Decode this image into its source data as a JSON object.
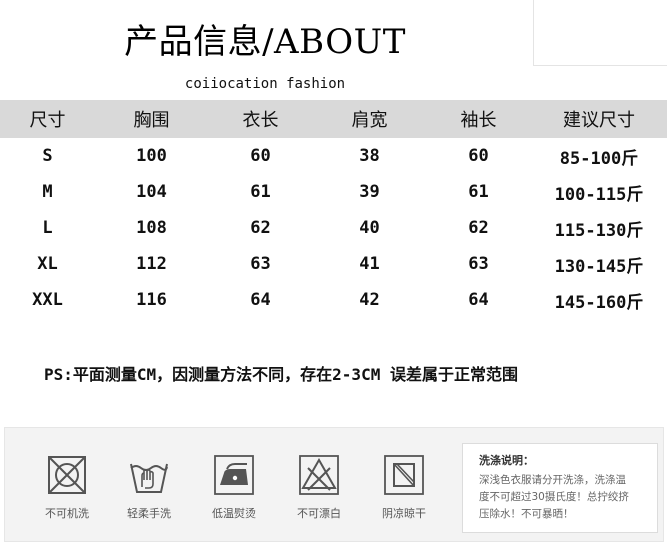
{
  "header": {
    "title": "产品信息/ABOUT",
    "subtitle": "coiiocation fashion"
  },
  "size_table": {
    "columns": [
      "尺寸",
      "胸围",
      "衣长",
      "肩宽",
      "袖长",
      "建议尺寸"
    ],
    "rows": [
      [
        "S",
        "100",
        "60",
        "38",
        "60",
        "85-100斤"
      ],
      [
        "M",
        "104",
        "61",
        "39",
        "61",
        "100-115斤"
      ],
      [
        "L",
        "108",
        "62",
        "40",
        "62",
        "115-130斤"
      ],
      [
        "XL",
        "112",
        "63",
        "41",
        "63",
        "130-145斤"
      ],
      [
        "XXL",
        "116",
        "64",
        "42",
        "64",
        "145-160斤"
      ]
    ]
  },
  "note": "PS:平面测量CM，因测量方法不同，存在2-3CM 误差属于正常范围",
  "care": {
    "items": [
      {
        "icon": "no-machine-wash-icon",
        "label": "不可机洗"
      },
      {
        "icon": "gentle-hand-wash-icon",
        "label": "轻柔手洗"
      },
      {
        "icon": "low-temp-iron-icon",
        "label": "低温熨烫"
      },
      {
        "icon": "no-bleach-icon",
        "label": "不可漂白"
      },
      {
        "icon": "shade-dry-icon",
        "label": "阴凉晾干"
      }
    ],
    "wash_title": "洗涤说明：",
    "wash_lines": [
      "深浅色衣服请分开洗涤，洗涤温",
      "度不可超过30摄氏度！总拧绞挤",
      "压除水！不可暴晒！"
    ]
  },
  "colors": {
    "header_bg": "#d9d9d9",
    "panel_bg": "#f3f3f3",
    "icon_stroke": "#555555"
  }
}
